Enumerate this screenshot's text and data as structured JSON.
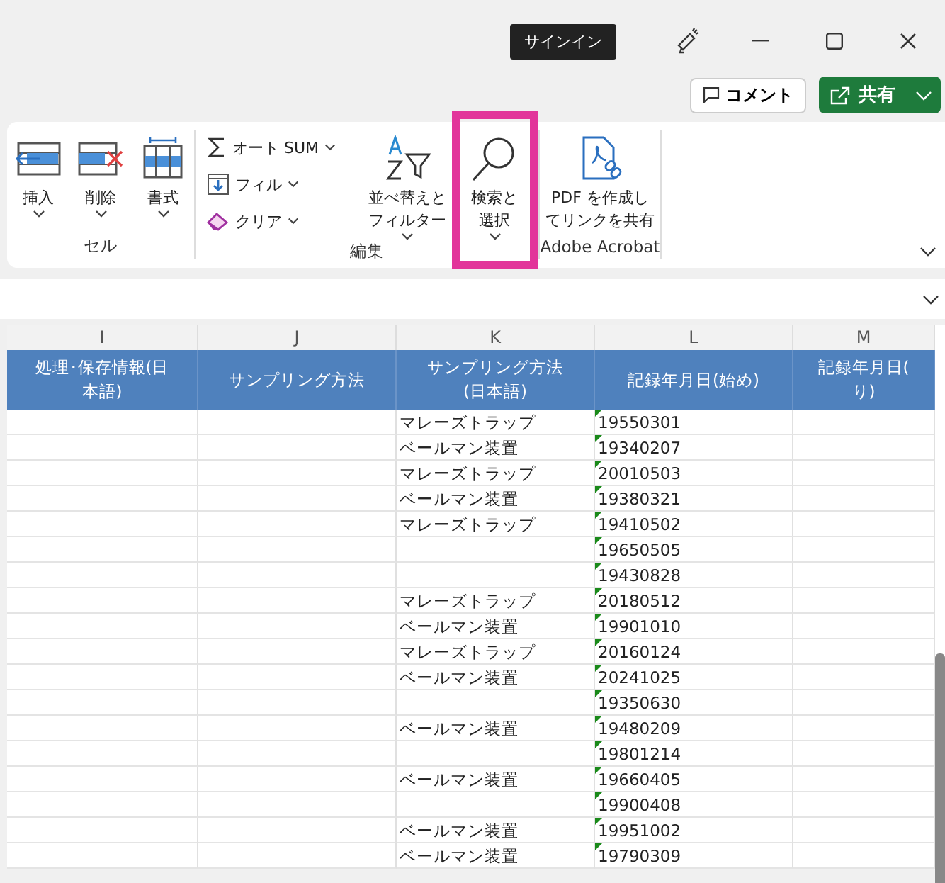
{
  "title_bar": {
    "signin": "サインイン",
    "comment": "コメント",
    "share": "共有"
  },
  "ribbon": {
    "groups": [
      {
        "label": "セル",
        "items": [
          {
            "kind": "large",
            "lines": [
              "挿入"
            ],
            "dropdown": true
          },
          {
            "kind": "large",
            "lines": [
              "削除"
            ],
            "dropdown": true
          },
          {
            "kind": "large",
            "lines": [
              "書式"
            ],
            "dropdown": true
          }
        ]
      },
      {
        "label": "編集",
        "items": [
          {
            "kind": "small",
            "lines": [
              "オート SUM"
            ],
            "dropdown": true
          },
          {
            "kind": "small",
            "lines": [
              "フィル"
            ],
            "dropdown": true
          },
          {
            "kind": "small",
            "lines": [
              "クリア"
            ],
            "dropdown": true
          },
          {
            "kind": "large",
            "lines": [
              "並べ替えと",
              "フィルター"
            ],
            "dropdown": true
          },
          {
            "kind": "large",
            "lines": [
              "検索と",
              "選択"
            ],
            "dropdown": true,
            "highlighted": true
          }
        ]
      },
      {
        "label": "Adobe Acrobat",
        "items": [
          {
            "kind": "large",
            "lines": [
              "PDF を作成し",
              "てリンクを共有"
            ],
            "dropdown": false
          }
        ]
      }
    ]
  },
  "sheet": {
    "columns": [
      "I",
      "J",
      "K",
      "L",
      "M"
    ],
    "headers": [
      [
        "処理･保存情報(日",
        "本語)"
      ],
      [
        "サンプリング方法"
      ],
      [
        "サンプリング方法",
        "(日本語)"
      ],
      [
        "記録年月日(始め)"
      ],
      [
        "記録年月日(",
        "り)"
      ]
    ],
    "rows": [
      {
        "k": "マレーズトラップ",
        "l": "19550301",
        "flag": true
      },
      {
        "k": "ベールマン装置",
        "l": "19340207",
        "flag": true
      },
      {
        "k": "マレーズトラップ",
        "l": "20010503",
        "flag": true
      },
      {
        "k": "ベールマン装置",
        "l": "19380321",
        "flag": true
      },
      {
        "k": "マレーズトラップ",
        "l": "19410502",
        "flag": true
      },
      {
        "k": "",
        "l": "19650505",
        "flag": true
      },
      {
        "k": "",
        "l": "19430828",
        "flag": true
      },
      {
        "k": "マレーズトラップ",
        "l": "20180512",
        "flag": true
      },
      {
        "k": "ベールマン装置",
        "l": "19901010",
        "flag": true
      },
      {
        "k": "マレーズトラップ",
        "l": "20160124",
        "flag": true
      },
      {
        "k": "ベールマン装置",
        "l": "20241025",
        "flag": true
      },
      {
        "k": "",
        "l": "19350630",
        "flag": true
      },
      {
        "k": "ベールマン装置",
        "l": "19480209",
        "flag": true
      },
      {
        "k": "",
        "l": "19801214",
        "flag": true
      },
      {
        "k": "ベールマン装置",
        "l": "19660405",
        "flag": true
      },
      {
        "k": "",
        "l": "19900408",
        "flag": true
      },
      {
        "k": "ベールマン装置",
        "l": "19951002",
        "flag": true
      },
      {
        "k": "ベールマン装置",
        "l": "19790309",
        "flag": true
      }
    ]
  }
}
